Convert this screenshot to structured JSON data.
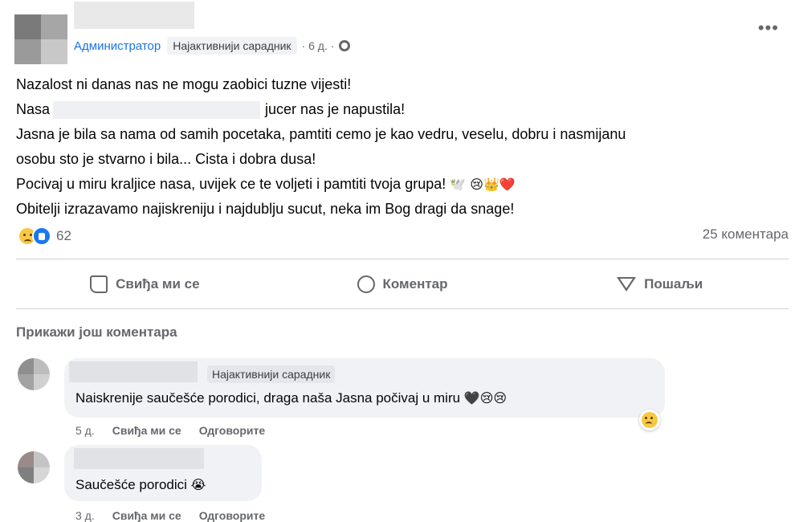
{
  "post": {
    "role": "Администратор",
    "badge": "Најактивнији сарадник",
    "time": "· 6 д. ·",
    "lines": [
      "Nazalost ni danas nas ne mogu zaobici tuzne vijesti!",
      "Nasa",
      "jucer nas je napustila!",
      "Jasna je bila sa nama od samih pocetaka, pamtiti cemo je kao vedru, veselu, dobru i nasmijanu",
      "osobu sto je stvarno i bila... Cista i dobra dusa!",
      "Pocivaj u miru kraljice nasa, uvijek ce te voljeti i pamtiti tvoja grupa!",
      "Obitelji izrazavamo najiskreniju i najdublju sucut, neka im Bog dragi da snage!"
    ],
    "line5_emoji": "🕊️ 😢👑❤️",
    "reaction_count": "62",
    "comments_count": "25 коментара"
  },
  "actions": {
    "like": "Свиђа ми се",
    "comment": "Коментар",
    "share": "Пошаљи"
  },
  "more_comments": "Прикажи још коментара",
  "comments": [
    {
      "badge": "Најактивнији сарадник",
      "text": "Naiskrenije saučešće porodici, draga naša Jasna počivaj u miru",
      "emoji": "🖤😢😢",
      "time": "5 д.",
      "like": "Свиђа ми се",
      "reply": "Одговорите"
    },
    {
      "text": "Saučešće porodici",
      "emoji": "😭",
      "time": "3 д.",
      "like": "Свиђа ми се",
      "reply": "Одговорите"
    }
  ],
  "colors": {
    "accent": "#1b74e4",
    "muted": "#65676b",
    "bubble": "#f0f2f5"
  },
  "icons": [
    "more-options-icon",
    "globe-icon",
    "sad-reaction-icon",
    "like-reaction-icon",
    "like-icon",
    "comment-icon",
    "share-icon"
  ]
}
